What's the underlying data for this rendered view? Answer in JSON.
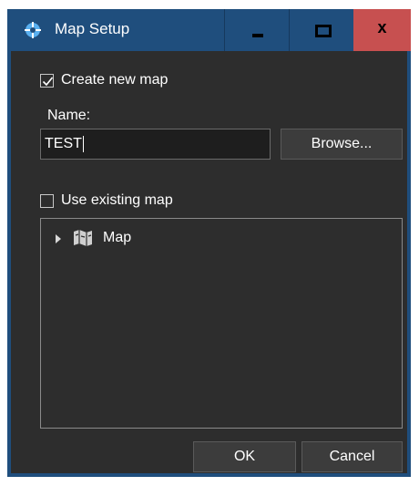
{
  "window": {
    "title": "Map Setup",
    "close_glyph": "x"
  },
  "create_new": {
    "label": "Create new map",
    "checked": true
  },
  "name": {
    "label": "Name:",
    "value": "TEST"
  },
  "browse_label": "Browse...",
  "use_existing": {
    "label": "Use existing map",
    "checked": false
  },
  "tree": {
    "items": [
      {
        "label": "Map",
        "icon": "map-icon"
      }
    ]
  },
  "buttons": {
    "ok": "OK",
    "cancel": "Cancel"
  },
  "colors": {
    "title_bar": "#1f4e7d",
    "close_button": "#c75050",
    "client_bg": "#2d2d2d"
  }
}
